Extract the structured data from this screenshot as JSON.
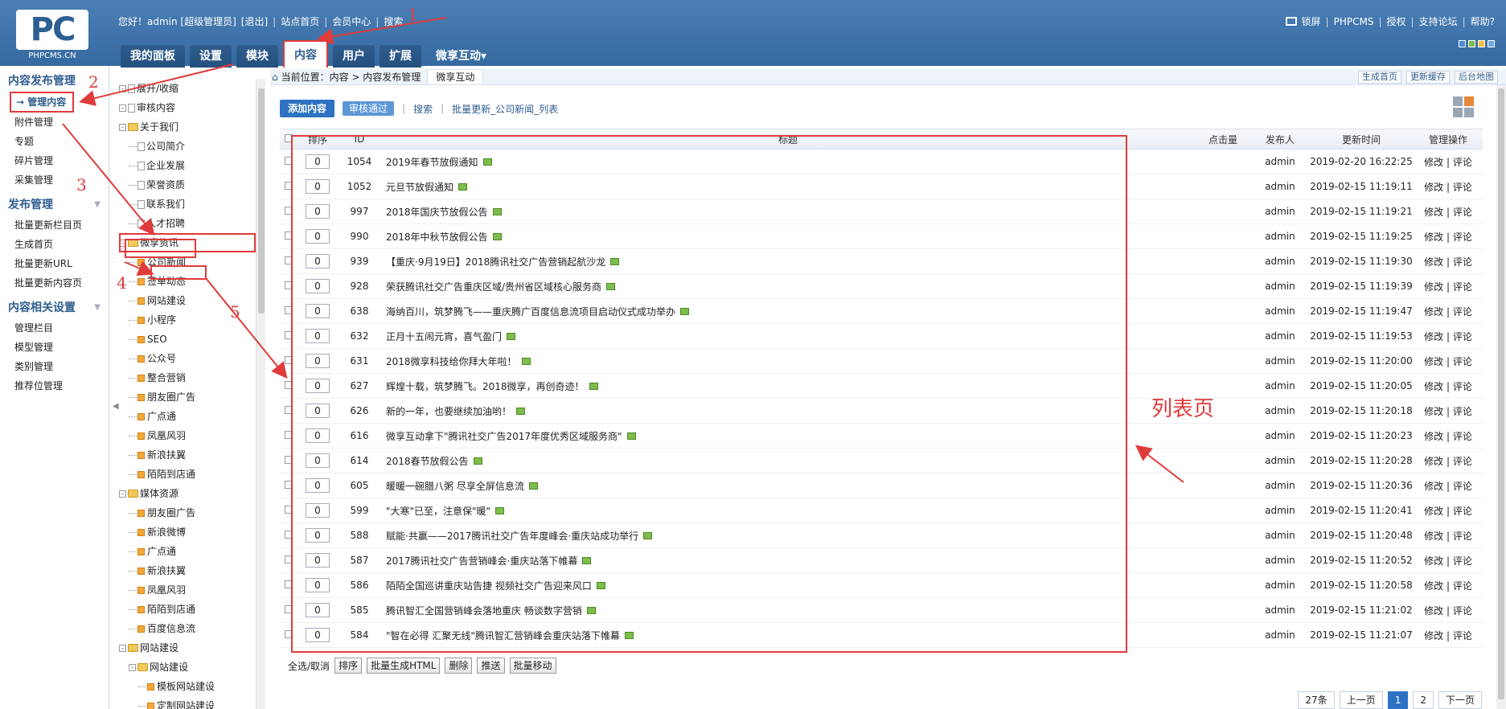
{
  "logo": {
    "sub": "PHPCMS.CN"
  },
  "topbar": {
    "greeting": "您好！admin [超级管理员]",
    "logout": "[退出]",
    "site_home": "站点首页",
    "member_center": "会员中心",
    "search": "搜索"
  },
  "nav": {
    "tabs": [
      "我的面板",
      "设置",
      "模块",
      "内容",
      "用户",
      "扩展",
      "微享互动▾"
    ]
  },
  "rightbar": {
    "lock": "锁屏",
    "brand": "PHPCMS",
    "license": "授权",
    "forum": "支持论坛",
    "help": "帮助?"
  },
  "leftnav": {
    "group1_title": "内容发布管理",
    "group1_items": [
      "管理内容",
      "附件管理",
      "专题",
      "碎片管理",
      "采集管理"
    ],
    "group2_title": "发布管理",
    "group2_items": [
      "批量更新栏目页",
      "生成首页",
      "批量更新URL",
      "批量更新内容页"
    ],
    "group3_title": "内容相关设置",
    "group3_items": [
      "管理栏目",
      "模型管理",
      "类别管理",
      "推荐位管理"
    ]
  },
  "tree": [
    "展开/收缩",
    "审核内容",
    "关于我们",
    "公司简介",
    "企业发展",
    "荣誉资质",
    "联系我们",
    "人才招聘",
    "微享资讯",
    "公司新闻",
    "签单动态",
    "网站建设",
    "小程序",
    "SEO",
    "公众号",
    "整合营销",
    "朋友圈广告",
    "广点通",
    "凤凰风羽",
    "新浪扶翼",
    "陌陌到店通",
    "媒体资源",
    "朋友圈广告",
    "新浪微博",
    "广点通",
    "新浪扶翼",
    "凤凰风羽",
    "陌陌到店通",
    "百度信息流",
    "网站建设",
    "网站建设",
    "模板网站建设",
    "定制网站建设"
  ],
  "crumb": {
    "label": "当前位置：内容 > 内容发布管理",
    "sub_tab": "微享互动",
    "actions": [
      "生成首页",
      "更新缓存",
      "后台地图"
    ]
  },
  "toolbar": {
    "add": "添加内容",
    "audit": "审核通过",
    "search": "搜索",
    "batch": "批量更新_公司新闻_列表"
  },
  "table": {
    "headers": {
      "order": "排序",
      "id": "ID",
      "title": "标题",
      "hits": "点击量",
      "user": "发布人",
      "time": "更新时间",
      "op": "管理操作"
    },
    "rows": [
      {
        "order": "0",
        "id": "1054",
        "title": "2019年春节放假通知",
        "user": "admin",
        "time": "2019-02-20 16:22:25",
        "op": "修改 | 评论"
      },
      {
        "order": "0",
        "id": "1052",
        "title": "元旦节放假通知",
        "user": "admin",
        "time": "2019-02-15 11:19:11",
        "op": "修改 | 评论"
      },
      {
        "order": "0",
        "id": "997",
        "title": "2018年国庆节放假公告",
        "user": "admin",
        "time": "2019-02-15 11:19:21",
        "op": "修改 | 评论"
      },
      {
        "order": "0",
        "id": "990",
        "title": "2018年中秋节放假公告",
        "user": "admin",
        "time": "2019-02-15 11:19:25",
        "op": "修改 | 评论"
      },
      {
        "order": "0",
        "id": "939",
        "title": "【重庆·9月19日】2018腾讯社交广告营销起航沙龙",
        "user": "admin",
        "time": "2019-02-15 11:19:30",
        "op": "修改 | 评论"
      },
      {
        "order": "0",
        "id": "928",
        "title": "荣获腾讯社交广告重庆区域/贵州省区域核心服务商",
        "user": "admin",
        "time": "2019-02-15 11:19:39",
        "op": "修改 | 评论"
      },
      {
        "order": "0",
        "id": "638",
        "title": "海纳百川，筑梦腾飞——重庆腾广百度信息流项目启动仪式成功举办",
        "user": "admin",
        "time": "2019-02-15 11:19:47",
        "op": "修改 | 评论"
      },
      {
        "order": "0",
        "id": "632",
        "title": "正月十五闹元宵，喜气盈门",
        "user": "admin",
        "time": "2019-02-15 11:19:53",
        "op": "修改 | 评论"
      },
      {
        "order": "0",
        "id": "631",
        "title": "2018微享科技给你拜大年啦！",
        "user": "admin",
        "time": "2019-02-15 11:20:00",
        "op": "修改 | 评论"
      },
      {
        "order": "0",
        "id": "627",
        "title": "辉煌十载，筑梦腾飞。2018微享，再创奇迹！",
        "user": "admin",
        "time": "2019-02-15 11:20:05",
        "op": "修改 | 评论"
      },
      {
        "order": "0",
        "id": "626",
        "title": "新的一年，也要继续加油哟！",
        "user": "admin",
        "time": "2019-02-15 11:20:18",
        "op": "修改 | 评论"
      },
      {
        "order": "0",
        "id": "616",
        "title": "微享互动拿下\"腾讯社交广告2017年度优秀区域服务商\"",
        "user": "admin",
        "time": "2019-02-15 11:20:23",
        "op": "修改 | 评论"
      },
      {
        "order": "0",
        "id": "614",
        "title": "2018春节放假公告",
        "user": "admin",
        "time": "2019-02-15 11:20:28",
        "op": "修改 | 评论"
      },
      {
        "order": "0",
        "id": "605",
        "title": "暖暖一碗腊八粥 尽享全屏信息流",
        "user": "admin",
        "time": "2019-02-15 11:20:36",
        "op": "修改 | 评论"
      },
      {
        "order": "0",
        "id": "599",
        "title": "\"大寒\"已至，注意保\"暖\"",
        "user": "admin",
        "time": "2019-02-15 11:20:41",
        "op": "修改 | 评论"
      },
      {
        "order": "0",
        "id": "588",
        "title": "赋能·共赢——2017腾讯社交广告年度峰会·重庆站成功举行",
        "user": "admin",
        "time": "2019-02-15 11:20:48",
        "op": "修改 | 评论"
      },
      {
        "order": "0",
        "id": "587",
        "title": "2017腾讯社交广告营销峰会·重庆站落下帷幕",
        "user": "admin",
        "time": "2019-02-15 11:20:52",
        "op": "修改 | 评论"
      },
      {
        "order": "0",
        "id": "586",
        "title": "陌陌全国巡讲重庆站告捷 视频社交广告迎来风口",
        "user": "admin",
        "time": "2019-02-15 11:20:58",
        "op": "修改 | 评论"
      },
      {
        "order": "0",
        "id": "585",
        "title": "腾讯智汇全国营销峰会落地重庆 畅谈数字营销",
        "user": "admin",
        "time": "2019-02-15 11:21:02",
        "op": "修改 | 评论"
      },
      {
        "order": "0",
        "id": "584",
        "title": "\"智在必得 汇聚无线\"腾讯智汇营销峰会重庆站落下帷幕",
        "user": "admin",
        "time": "2019-02-15 11:21:07",
        "op": "修改 | 评论"
      }
    ]
  },
  "bottombar": {
    "select_all": "全选/取消",
    "buttons": [
      "排序",
      "批量生成HTML",
      "删除",
      "推送",
      "批量移动"
    ]
  },
  "pager": {
    "total": "27条",
    "prev": "上一页",
    "pages": [
      "1",
      "2"
    ],
    "next": "下一页"
  },
  "annotations": {
    "nums": [
      "1",
      "2",
      "3",
      "4",
      "5"
    ],
    "list_label": "列表页"
  }
}
